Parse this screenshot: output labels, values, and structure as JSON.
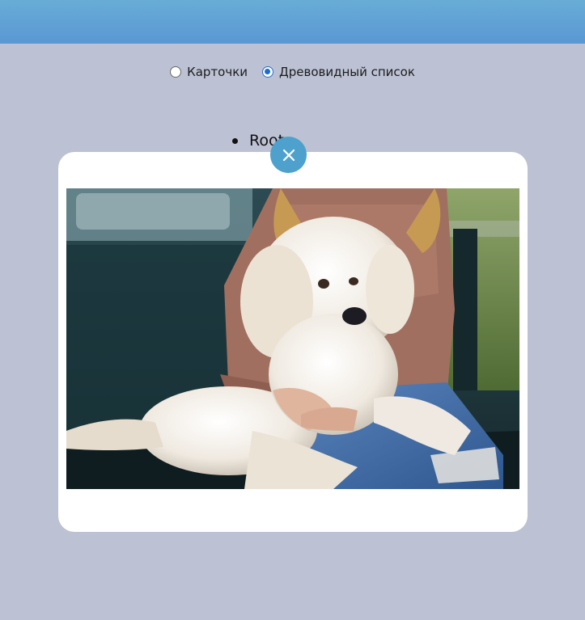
{
  "view_switch": {
    "options": [
      {
        "label": "Карточки",
        "checked": false
      },
      {
        "label": "Древовидный список",
        "checked": true
      }
    ]
  },
  "tree": {
    "root_label": "Root"
  },
  "modal": {
    "close_icon": "close-icon",
    "image_subject": "dog-photo"
  },
  "colors": {
    "topbar_start": "#68add6",
    "topbar_end": "#5a97d3",
    "background": "#bcc2d3",
    "close_button": "#4fa1cd",
    "radio_checked": "#1b6ad8"
  }
}
